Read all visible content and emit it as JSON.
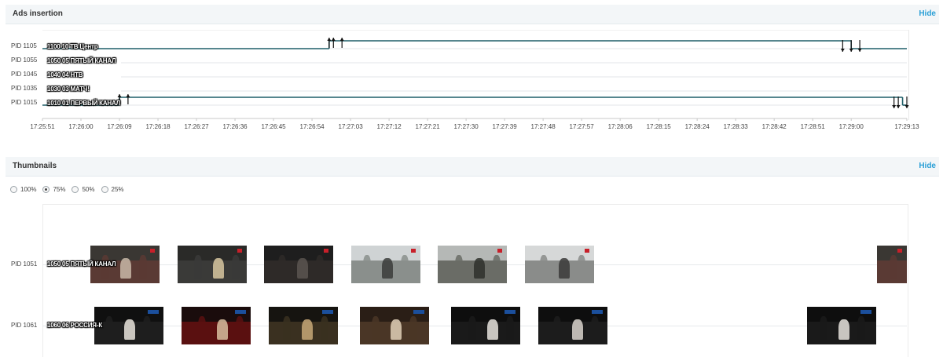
{
  "ads_panel": {
    "title": "Ads insertion",
    "hide_label": "Hide"
  },
  "ads_rows": [
    {
      "pid": "PID 1105",
      "channel": "1100 10 ТВ Центр"
    },
    {
      "pid": "PID 1055",
      "channel": "1050 05 ПЯТЫЙ КАНАЛ"
    },
    {
      "pid": "PID 1045",
      "channel": "1040 04 НТВ"
    },
    {
      "pid": "PID 1035",
      "channel": "1030 03 МАТЧ!"
    },
    {
      "pid": "PID 1015",
      "channel": "1010 01 ПЕРВЫЙ КАНАЛ"
    }
  ],
  "time_ticks": [
    "17:25:51",
    "17:26:00",
    "17:26:09",
    "17:26:18",
    "17:26:27",
    "17:26:36",
    "17:26:45",
    "17:26:54",
    "17:27:03",
    "17:27:12",
    "17:27:21",
    "17:27:30",
    "17:27:39",
    "17:27:48",
    "17:27:57",
    "17:28:06",
    "17:28:15",
    "17:28:24",
    "17:28:33",
    "17:28:42",
    "17:28:51",
    "17:29:00",
    "17:29:13"
  ],
  "ad_blocks": [
    {
      "row": 0,
      "start": "17:26:58",
      "end": "17:29:00",
      "starts": [
        "17:26:58",
        "17:26:59",
        "17:27:01"
      ],
      "ends": [
        "17:28:58",
        "17:29:00",
        "17:29:02"
      ]
    },
    {
      "row": 4,
      "start": "17:26:09",
      "end": "17:29:12",
      "starts": [
        "17:26:09",
        "17:26:11"
      ],
      "ends": [
        "17:29:10",
        "17:29:11",
        "17:29:13"
      ]
    }
  ],
  "thumbnails_panel": {
    "title": "Thumbnails",
    "hide_label": "Hide"
  },
  "size_options": [
    {
      "label": "100%",
      "selected": false
    },
    {
      "label": "75%",
      "selected": true
    },
    {
      "label": "50%",
      "selected": false
    },
    {
      "label": "25%",
      "selected": false
    }
  ],
  "thumb_rows": [
    {
      "pid": "PID 1051",
      "channel": "1050 05 ПЯТЫЙ КАНАЛ",
      "frames": 7
    },
    {
      "pid": "PID 1061",
      "channel": "1060 06 РОССИЯ-К",
      "frames": 7
    }
  ],
  "colors": {
    "accent": "#2a9fd6",
    "line": "#1e5e68",
    "header_bg": "#f3f6f8"
  }
}
